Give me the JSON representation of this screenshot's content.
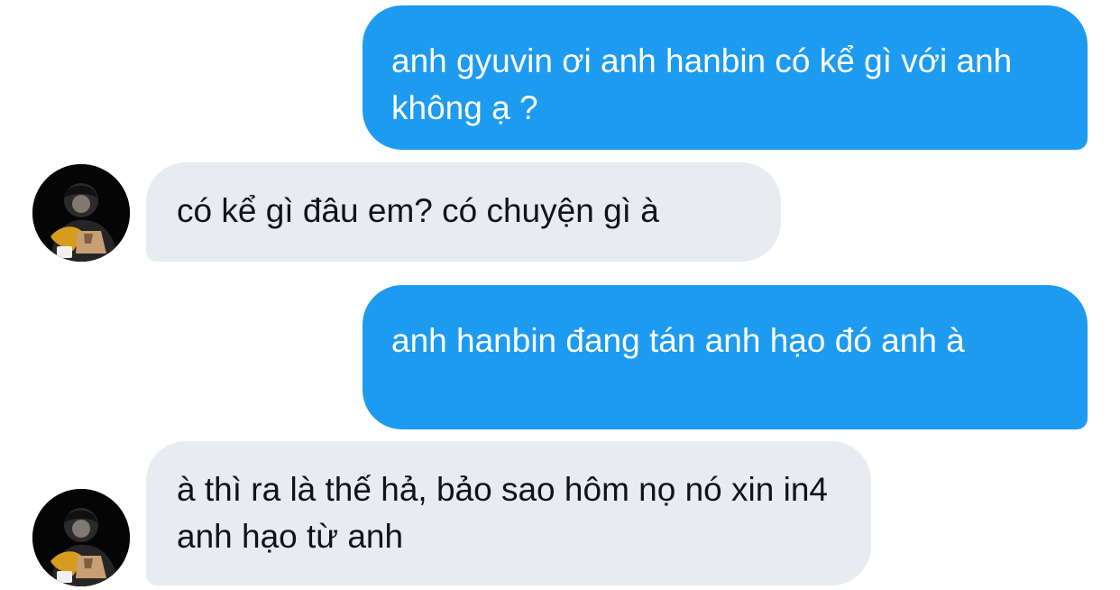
{
  "messages": [
    {
      "side": "outgoing",
      "text": "anh gyuvin ơi anh hanbin có kể gì với anh không ạ ?"
    },
    {
      "side": "incoming",
      "text": "có kể gì đâu em? có chuyện gì à"
    },
    {
      "side": "outgoing",
      "text": "anh hanbin đang tán anh hạo đó anh à"
    },
    {
      "side": "incoming",
      "text": "à thì ra là thế hả, bảo sao hôm nọ nó xin in4 anh hạo từ anh"
    }
  ],
  "colors": {
    "outgoing_bubble": "#1d9bf0",
    "incoming_bubble": "#e8ecf0",
    "incoming_text": "#0f1419",
    "outgoing_text": "#ffffff",
    "background": "#ffffff"
  },
  "icons": {
    "avatar": "profile-photo-avatar"
  }
}
